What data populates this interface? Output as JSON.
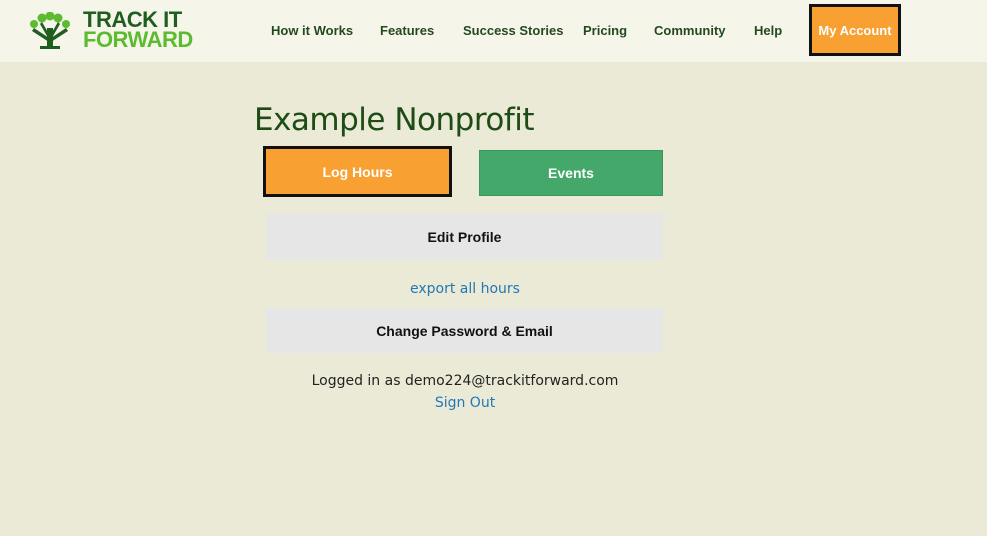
{
  "brand": {
    "line1": "TRACK IT",
    "line2": "FORWARD",
    "logo_icon": "tree-of-people-icon",
    "colors": {
      "dark_green": "#1f5e1e",
      "light_green": "#5cbb2f"
    }
  },
  "nav": {
    "items": [
      {
        "label": "How it Works"
      },
      {
        "label": "Features"
      },
      {
        "label": "Success Stories"
      },
      {
        "label": "Pricing"
      },
      {
        "label": "Community"
      },
      {
        "label": "Help"
      }
    ],
    "account_label": "My Account"
  },
  "main": {
    "org_title": "Example Nonprofit",
    "log_hours_label": "Log Hours",
    "events_label": "Events",
    "edit_profile_label": "Edit Profile",
    "export_link": "export all hours",
    "change_password_label": "Change Password & Email",
    "logged_in_text": "Logged in as demo224@trackitforward.com",
    "sign_out_link": "Sign Out"
  },
  "colors": {
    "background": "#ebead7",
    "header_bg": "#f6f5ea",
    "accent_orange": "#f9a033",
    "events_green": "#43a86a",
    "link_blue": "#2278b5",
    "title_green": "#1e4c17"
  }
}
